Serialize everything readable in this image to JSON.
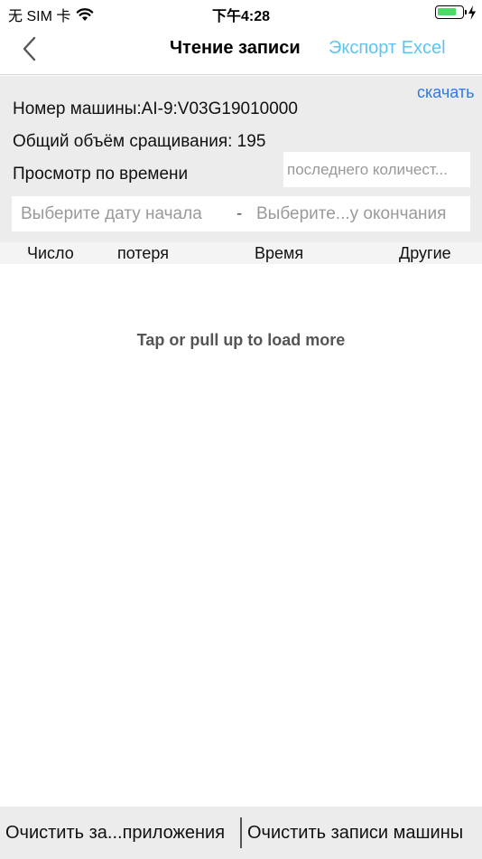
{
  "status_bar": {
    "carrier": "无 SIM 卡",
    "time": "下午4:28",
    "battery_color": "#4cd964"
  },
  "nav": {
    "title": "Чтение записи",
    "export_label": "Экспорт Excel",
    "back_icon": "chevron-left-icon"
  },
  "info": {
    "download_label": "скачать",
    "machine_number": "Номер машины:AI-9:V03G19010000",
    "total_label": "Общий объём сращивания:  195",
    "view_by_time_label": "Просмотр по времени",
    "count_placeholder": "последнего количест...",
    "start_date_placeholder": "Выберите дату начала",
    "date_separator": "-",
    "end_date_placeholder": "Выберите...у окончания"
  },
  "table": {
    "columns": [
      "Число",
      "потеря",
      "Время",
      "Другие"
    ]
  },
  "load_more": "Tap or pull up to load more",
  "bottom_bar": {
    "clear_app_label": "Очистить за...приложения",
    "clear_machine_label": "Очистить записи машины"
  },
  "colors": {
    "accent_export": "#5fc4f2",
    "link": "#2e7be0",
    "panel_bg": "#ececec"
  }
}
